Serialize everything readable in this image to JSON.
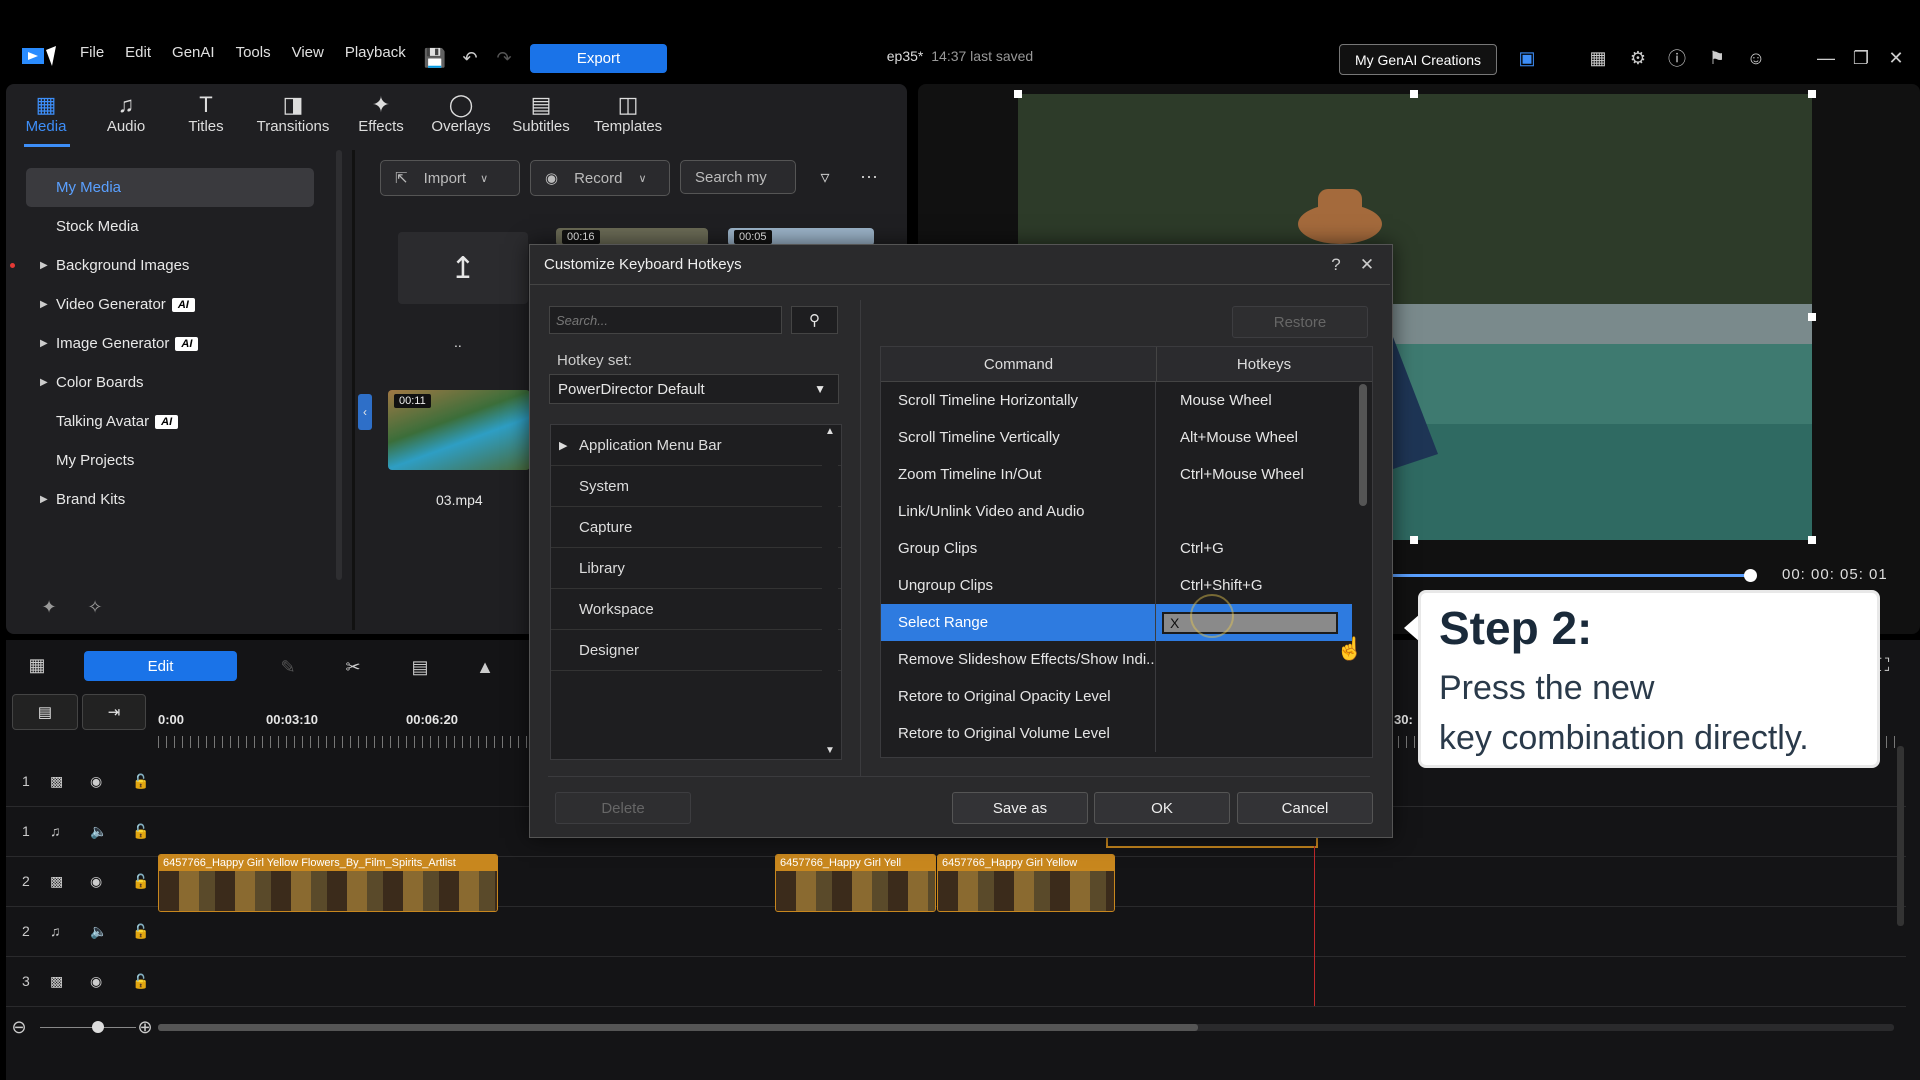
{
  "menu": {
    "items": [
      "File",
      "Edit",
      "GenAI",
      "Tools",
      "View",
      "Playback"
    ],
    "export_label": "Export"
  },
  "project": {
    "name": "ep35*",
    "saved": "14:37 last saved"
  },
  "genai_button": "My GenAI Creations",
  "tabs": [
    {
      "label": "Media",
      "icon": "media-icon",
      "active": true
    },
    {
      "label": "Audio",
      "icon": "music-note-icon"
    },
    {
      "label": "Titles",
      "icon": "text-icon"
    },
    {
      "label": "Transitions",
      "icon": "transition-icon"
    },
    {
      "label": "Effects",
      "icon": "effects-icon"
    },
    {
      "label": "Overlays",
      "icon": "overlays-icon"
    },
    {
      "label": "Subtitles",
      "icon": "subtitles-icon"
    },
    {
      "label": "Templates",
      "icon": "templates-icon"
    }
  ],
  "sidebar": {
    "items": [
      {
        "label": "My Media",
        "selected": true
      },
      {
        "label": "Stock Media"
      },
      {
        "label": "Background Images",
        "expandable": true
      },
      {
        "label": "Video Generator",
        "expandable": true,
        "badge": "AI"
      },
      {
        "label": "Image Generator",
        "expandable": true,
        "badge": "AI"
      },
      {
        "label": "Color Boards",
        "expandable": true
      },
      {
        "label": "Talking Avatar",
        "badge": "AI"
      },
      {
        "label": "My Projects"
      },
      {
        "label": "Brand Kits",
        "expandable": true
      }
    ]
  },
  "media_toolbar": {
    "import": "Import",
    "record": "Record",
    "search_placeholder": "Search my"
  },
  "media_items": [
    {
      "label": ".."
    },
    {
      "label": "03.mp4",
      "duration": "00:11"
    },
    {
      "duration": "00:16"
    },
    {
      "duration": "00:05"
    }
  ],
  "preview": {
    "timecode": "00: 00: 05: 01"
  },
  "timeline": {
    "edit_label": "Edit",
    "ruler": [
      "0:00",
      "00:03:10",
      "00:06:20",
      "30:"
    ],
    "tracks": [
      {
        "num": "1",
        "type": "video"
      },
      {
        "num": "1",
        "type": "audio"
      },
      {
        "num": "2",
        "type": "video"
      },
      {
        "num": "2",
        "type": "audio"
      },
      {
        "num": "3",
        "type": "video"
      }
    ],
    "clips": [
      "6457766_Happy Girl Yellow Flowers_By_Film_Spirits_Artlist",
      "6457766_Happy Girl Yell",
      "6457766_Happy Girl Yellow"
    ]
  },
  "dialog": {
    "title": "Customize Keyboard Hotkeys",
    "search_placeholder": "Search...",
    "hotkey_set_label": "Hotkey set:",
    "hotkey_set_value": "PowerDirector Default",
    "restore": "Restore",
    "categories": [
      "Application Menu Bar",
      "System",
      "Capture",
      "Library",
      "Workspace",
      "Designer"
    ],
    "table_headers": {
      "command": "Command",
      "hotkeys": "Hotkeys"
    },
    "rows": [
      {
        "command": "Scroll Timeline Horizontally",
        "hotkey": "Mouse Wheel"
      },
      {
        "command": "Scroll Timeline Vertically",
        "hotkey": "Alt+Mouse Wheel"
      },
      {
        "command": "Zoom Timeline In/Out",
        "hotkey": "Ctrl+Mouse Wheel"
      },
      {
        "command": "Link/Unlink Video and Audio",
        "hotkey": ""
      },
      {
        "command": "Group Clips",
        "hotkey": "Ctrl+G"
      },
      {
        "command": "Ungroup Clips",
        "hotkey": "Ctrl+Shift+G"
      },
      {
        "command": "Select Range",
        "hotkey": "X",
        "selected": true
      },
      {
        "command": "Remove Slideshow Effects/Show Indi...",
        "hotkey": ""
      },
      {
        "command": "Retore to Original Opacity Level",
        "hotkey": ""
      },
      {
        "command": "Retore to Original Volume Level",
        "hotkey": ""
      }
    ],
    "buttons": {
      "delete": "Delete",
      "save_as": "Save as",
      "ok": "OK",
      "cancel": "Cancel"
    }
  },
  "step_card": {
    "heading": "Step 2:",
    "line1": "Press the new",
    "line2": "key combination directly."
  },
  "colors": {
    "accent": "#1a73e8",
    "selection": "#2e7be0",
    "clip": "#c8871e"
  }
}
